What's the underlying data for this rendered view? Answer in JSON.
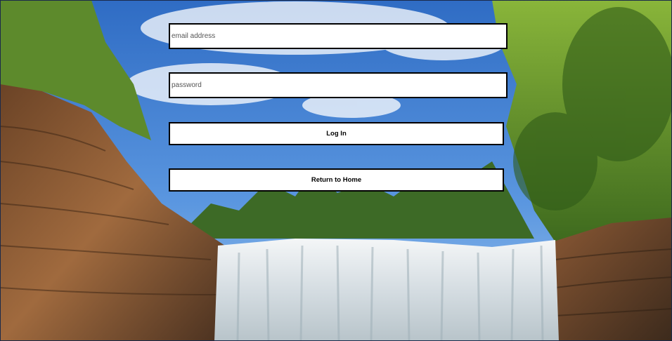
{
  "login_form": {
    "email_placeholder": "email address",
    "email_value": "",
    "password_placeholder": "password",
    "password_value": "",
    "login_label": "Log In",
    "home_label": "Return to Home"
  },
  "background": {
    "description_icon": "waterfall-scene",
    "sky_color": "#3f7fd2",
    "foliage_color": "#6b9a2a",
    "cliff_color": "#8a5a34",
    "water_color": "#e6ecef"
  }
}
